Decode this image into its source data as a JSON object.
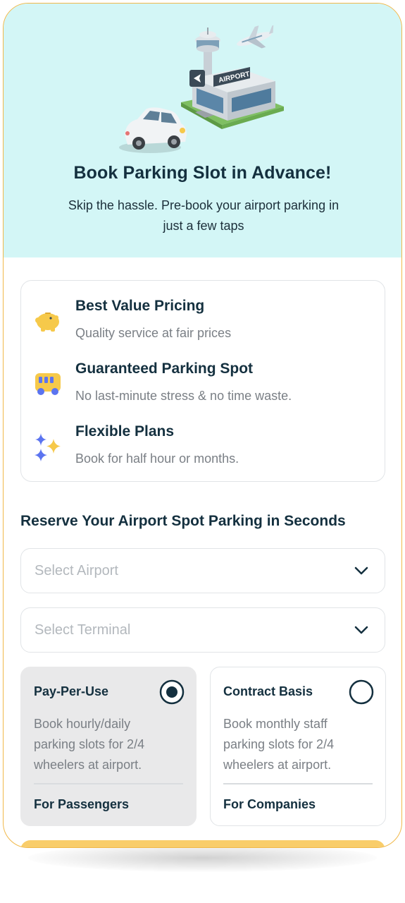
{
  "hero": {
    "illustration_icon": "car-and-airport-illustration",
    "airport_sign": "AIRPORT",
    "title": "Book Parking Slot in Advance!",
    "subtitle": "Skip the hassle. Pre-book your airport parking in just a few taps"
  },
  "features": [
    {
      "icon": "piggy-bank-icon",
      "title": "Best Value Pricing",
      "description": "Quality service at fair prices"
    },
    {
      "icon": "bus-icon",
      "title": "Guaranteed Parking Spot",
      "description": "No last-minute stress & no time waste."
    },
    {
      "icon": "sparkle-icon",
      "title": "Flexible Plans",
      "description": "Book for half hour or months."
    }
  ],
  "reserve": {
    "title": "Reserve Your Airport Spot Parking in Seconds",
    "airport_placeholder": "Select Airport",
    "terminal_placeholder": "Select Terminal"
  },
  "plans": [
    {
      "title": "Pay-Per-Use",
      "description": "Book hourly/daily parking slots for 2/4 wheelers at airport.",
      "footer": "For Passengers",
      "selected": true
    },
    {
      "title": "Contract Basis",
      "description": "Book monthly staff parking slots for 2/4 wheelers at airport.",
      "footer": "For Companies",
      "selected": false
    }
  ],
  "colors": {
    "hero_bg": "#d3f6f6",
    "primary_text": "#14303f",
    "muted_text": "#7a7f85",
    "accent_yellow": "#f9cd6a",
    "feature_icon_yellow": "#f6c94a",
    "feature_icon_blue": "#5b74f0",
    "frame_border": "#f0b84a"
  }
}
